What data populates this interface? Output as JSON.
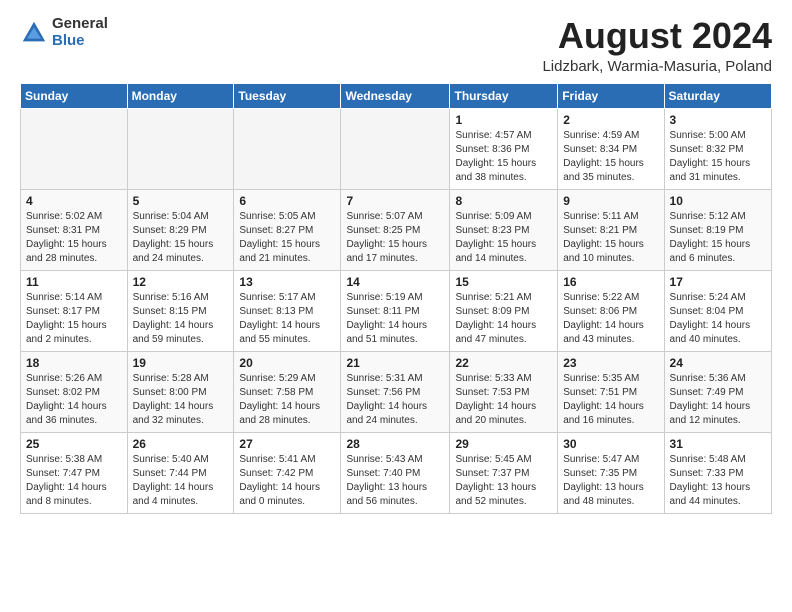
{
  "logo": {
    "general": "General",
    "blue": "Blue"
  },
  "title": "August 2024",
  "location": "Lidzbark, Warmia-Masuria, Poland",
  "weekdays": [
    "Sunday",
    "Monday",
    "Tuesday",
    "Wednesday",
    "Thursday",
    "Friday",
    "Saturday"
  ],
  "weeks": [
    [
      {
        "day": "",
        "info": ""
      },
      {
        "day": "",
        "info": ""
      },
      {
        "day": "",
        "info": ""
      },
      {
        "day": "",
        "info": ""
      },
      {
        "day": "1",
        "info": "Sunrise: 4:57 AM\nSunset: 8:36 PM\nDaylight: 15 hours\nand 38 minutes."
      },
      {
        "day": "2",
        "info": "Sunrise: 4:59 AM\nSunset: 8:34 PM\nDaylight: 15 hours\nand 35 minutes."
      },
      {
        "day": "3",
        "info": "Sunrise: 5:00 AM\nSunset: 8:32 PM\nDaylight: 15 hours\nand 31 minutes."
      }
    ],
    [
      {
        "day": "4",
        "info": "Sunrise: 5:02 AM\nSunset: 8:31 PM\nDaylight: 15 hours\nand 28 minutes."
      },
      {
        "day": "5",
        "info": "Sunrise: 5:04 AM\nSunset: 8:29 PM\nDaylight: 15 hours\nand 24 minutes."
      },
      {
        "day": "6",
        "info": "Sunrise: 5:05 AM\nSunset: 8:27 PM\nDaylight: 15 hours\nand 21 minutes."
      },
      {
        "day": "7",
        "info": "Sunrise: 5:07 AM\nSunset: 8:25 PM\nDaylight: 15 hours\nand 17 minutes."
      },
      {
        "day": "8",
        "info": "Sunrise: 5:09 AM\nSunset: 8:23 PM\nDaylight: 15 hours\nand 14 minutes."
      },
      {
        "day": "9",
        "info": "Sunrise: 5:11 AM\nSunset: 8:21 PM\nDaylight: 15 hours\nand 10 minutes."
      },
      {
        "day": "10",
        "info": "Sunrise: 5:12 AM\nSunset: 8:19 PM\nDaylight: 15 hours\nand 6 minutes."
      }
    ],
    [
      {
        "day": "11",
        "info": "Sunrise: 5:14 AM\nSunset: 8:17 PM\nDaylight: 15 hours\nand 2 minutes."
      },
      {
        "day": "12",
        "info": "Sunrise: 5:16 AM\nSunset: 8:15 PM\nDaylight: 14 hours\nand 59 minutes."
      },
      {
        "day": "13",
        "info": "Sunrise: 5:17 AM\nSunset: 8:13 PM\nDaylight: 14 hours\nand 55 minutes."
      },
      {
        "day": "14",
        "info": "Sunrise: 5:19 AM\nSunset: 8:11 PM\nDaylight: 14 hours\nand 51 minutes."
      },
      {
        "day": "15",
        "info": "Sunrise: 5:21 AM\nSunset: 8:09 PM\nDaylight: 14 hours\nand 47 minutes."
      },
      {
        "day": "16",
        "info": "Sunrise: 5:22 AM\nSunset: 8:06 PM\nDaylight: 14 hours\nand 43 minutes."
      },
      {
        "day": "17",
        "info": "Sunrise: 5:24 AM\nSunset: 8:04 PM\nDaylight: 14 hours\nand 40 minutes."
      }
    ],
    [
      {
        "day": "18",
        "info": "Sunrise: 5:26 AM\nSunset: 8:02 PM\nDaylight: 14 hours\nand 36 minutes."
      },
      {
        "day": "19",
        "info": "Sunrise: 5:28 AM\nSunset: 8:00 PM\nDaylight: 14 hours\nand 32 minutes."
      },
      {
        "day": "20",
        "info": "Sunrise: 5:29 AM\nSunset: 7:58 PM\nDaylight: 14 hours\nand 28 minutes."
      },
      {
        "day": "21",
        "info": "Sunrise: 5:31 AM\nSunset: 7:56 PM\nDaylight: 14 hours\nand 24 minutes."
      },
      {
        "day": "22",
        "info": "Sunrise: 5:33 AM\nSunset: 7:53 PM\nDaylight: 14 hours\nand 20 minutes."
      },
      {
        "day": "23",
        "info": "Sunrise: 5:35 AM\nSunset: 7:51 PM\nDaylight: 14 hours\nand 16 minutes."
      },
      {
        "day": "24",
        "info": "Sunrise: 5:36 AM\nSunset: 7:49 PM\nDaylight: 14 hours\nand 12 minutes."
      }
    ],
    [
      {
        "day": "25",
        "info": "Sunrise: 5:38 AM\nSunset: 7:47 PM\nDaylight: 14 hours\nand 8 minutes."
      },
      {
        "day": "26",
        "info": "Sunrise: 5:40 AM\nSunset: 7:44 PM\nDaylight: 14 hours\nand 4 minutes."
      },
      {
        "day": "27",
        "info": "Sunrise: 5:41 AM\nSunset: 7:42 PM\nDaylight: 14 hours\nand 0 minutes."
      },
      {
        "day": "28",
        "info": "Sunrise: 5:43 AM\nSunset: 7:40 PM\nDaylight: 13 hours\nand 56 minutes."
      },
      {
        "day": "29",
        "info": "Sunrise: 5:45 AM\nSunset: 7:37 PM\nDaylight: 13 hours\nand 52 minutes."
      },
      {
        "day": "30",
        "info": "Sunrise: 5:47 AM\nSunset: 7:35 PM\nDaylight: 13 hours\nand 48 minutes."
      },
      {
        "day": "31",
        "info": "Sunrise: 5:48 AM\nSunset: 7:33 PM\nDaylight: 13 hours\nand 44 minutes."
      }
    ]
  ]
}
